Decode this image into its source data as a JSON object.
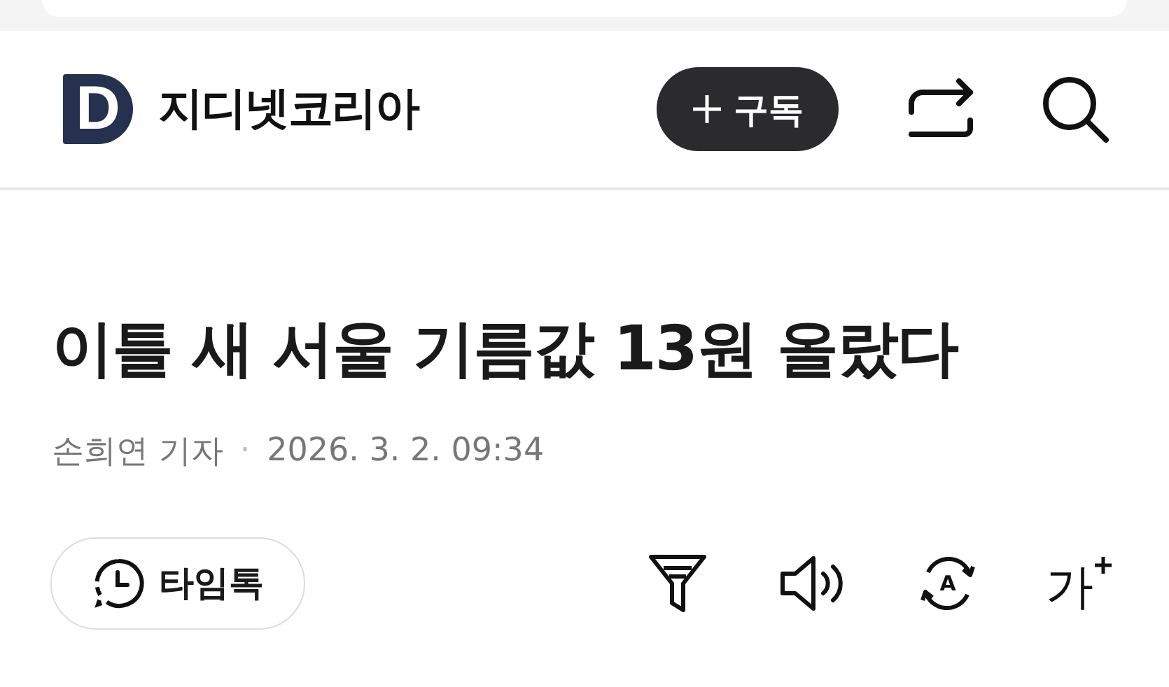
{
  "header": {
    "logo_letter": "D",
    "site_name": "지디넷코리아",
    "subscribe_label": "구독"
  },
  "article": {
    "headline": "이틀 새 서울 기름값 13원 올랐다",
    "byline": "손희연 기자",
    "separator": "·",
    "date": "2026. 3. 2. 09:34"
  },
  "toolbar": {
    "timetalk_label": "타임톡",
    "translate_letter": "A",
    "font_size_label": "가"
  }
}
